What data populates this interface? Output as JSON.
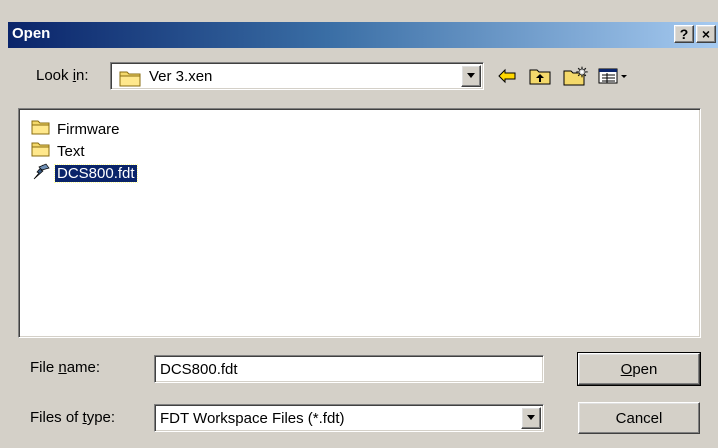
{
  "dialog": {
    "title": "Open",
    "help_label": "?",
    "close_label": "×"
  },
  "look_in": {
    "label_pre": "Look ",
    "label_ul": "i",
    "label_post": "n:",
    "value": "Ver 3.xen"
  },
  "files": [
    {
      "name": "Firmware",
      "icon": "folder-icon",
      "selected": false
    },
    {
      "name": "Text",
      "icon": "folder-icon",
      "selected": false
    },
    {
      "name": "DCS800.fdt",
      "icon": "fdt-file-icon",
      "selected": true
    }
  ],
  "file_name": {
    "label_pre": "File ",
    "label_ul": "n",
    "label_post": "ame:",
    "value": "DCS800.fdt"
  },
  "file_type": {
    "label_pre": "Files of ",
    "label_ul": "t",
    "label_post": "ype:",
    "value": "FDT Workspace Files (*.fdt)"
  },
  "buttons": {
    "open_ul": "O",
    "open_rest": "pen",
    "cancel": "Cancel"
  },
  "colors": {
    "title_start": "#0a246a",
    "title_end": "#a6caf0",
    "selection": "#0a246a",
    "face": "#d4d0c8"
  }
}
